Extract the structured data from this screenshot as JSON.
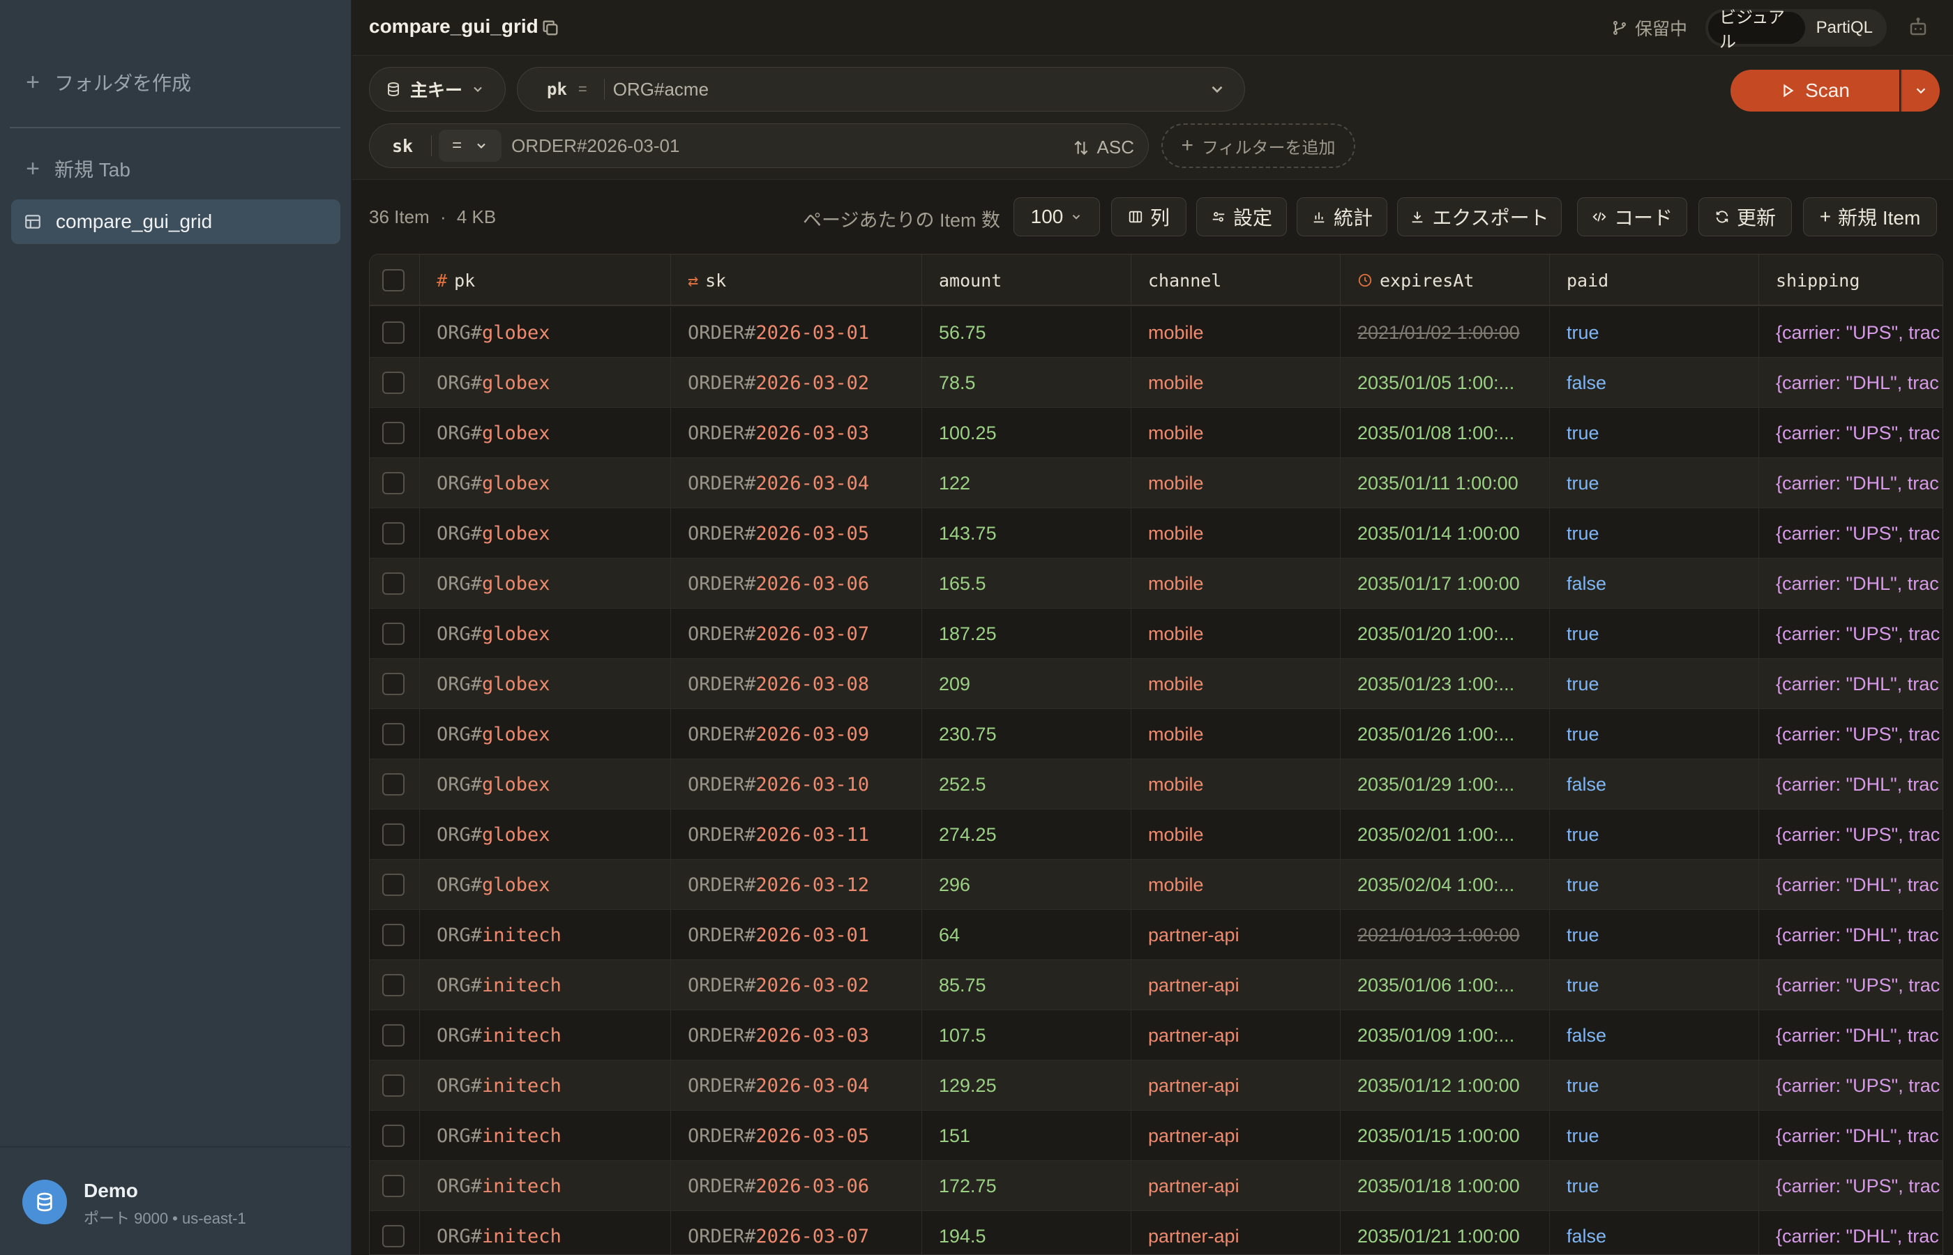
{
  "sidebar": {
    "create_folder": "フォルダを作成",
    "new_tab": "新規 Tab",
    "active_tab": "compare_gui_grid",
    "connection": {
      "name": "Demo",
      "detail": "ポート 9000 • us-east-1"
    }
  },
  "header": {
    "title": "compare_gui_grid",
    "pending": "保留中",
    "modes": [
      "ビジュアル",
      "PartiQL"
    ]
  },
  "query": {
    "index_label": "主キー",
    "pk_name": "pk",
    "pk_op": "=",
    "pk_value": "ORG#acme",
    "sk_name": "sk",
    "sk_op": "=",
    "sk_value": "ORDER#2026-03-01",
    "sort": "ASC",
    "add_filter": "フィルターを追加",
    "scan_label": "Scan"
  },
  "toolbar": {
    "item_count": "36 Item",
    "size": "4 KB",
    "per_page_label": "ページあたりの Item 数",
    "per_page_value": "100",
    "columns": "列",
    "settings": "設定",
    "stats": "統計",
    "export": "エクスポート",
    "code": "コード",
    "refresh": "更新",
    "new_item": "新規 Item"
  },
  "table": {
    "columns": [
      "pk",
      "sk",
      "amount",
      "channel",
      "expiresAt",
      "paid",
      "shipping"
    ],
    "rows": [
      {
        "pk_prefix": "ORG#",
        "pk_value": "globex",
        "sk_prefix": "ORDER#",
        "sk_value": "2026-03-01",
        "amount": "56.75",
        "channel": "mobile",
        "expiresAt": "2021/01/02 1:00:00",
        "expired": true,
        "paid": "true",
        "shipping": "{carrier: \"UPS\", trac"
      },
      {
        "pk_prefix": "ORG#",
        "pk_value": "globex",
        "sk_prefix": "ORDER#",
        "sk_value": "2026-03-02",
        "amount": "78.5",
        "channel": "mobile",
        "expiresAt": "2035/01/05 1:00:...",
        "expired": false,
        "paid": "false",
        "shipping": "{carrier: \"DHL\", trac"
      },
      {
        "pk_prefix": "ORG#",
        "pk_value": "globex",
        "sk_prefix": "ORDER#",
        "sk_value": "2026-03-03",
        "amount": "100.25",
        "channel": "mobile",
        "expiresAt": "2035/01/08 1:00:...",
        "expired": false,
        "paid": "true",
        "shipping": "{carrier: \"UPS\", trac"
      },
      {
        "pk_prefix": "ORG#",
        "pk_value": "globex",
        "sk_prefix": "ORDER#",
        "sk_value": "2026-03-04",
        "amount": "122",
        "channel": "mobile",
        "expiresAt": "2035/01/11 1:00:00",
        "expired": false,
        "paid": "true",
        "shipping": "{carrier: \"DHL\", trac"
      },
      {
        "pk_prefix": "ORG#",
        "pk_value": "globex",
        "sk_prefix": "ORDER#",
        "sk_value": "2026-03-05",
        "amount": "143.75",
        "channel": "mobile",
        "expiresAt": "2035/01/14 1:00:00",
        "expired": false,
        "paid": "true",
        "shipping": "{carrier: \"UPS\", trac"
      },
      {
        "pk_prefix": "ORG#",
        "pk_value": "globex",
        "sk_prefix": "ORDER#",
        "sk_value": "2026-03-06",
        "amount": "165.5",
        "channel": "mobile",
        "expiresAt": "2035/01/17 1:00:00",
        "expired": false,
        "paid": "false",
        "shipping": "{carrier: \"DHL\", trac"
      },
      {
        "pk_prefix": "ORG#",
        "pk_value": "globex",
        "sk_prefix": "ORDER#",
        "sk_value": "2026-03-07",
        "amount": "187.25",
        "channel": "mobile",
        "expiresAt": "2035/01/20 1:00:...",
        "expired": false,
        "paid": "true",
        "shipping": "{carrier: \"UPS\", trac"
      },
      {
        "pk_prefix": "ORG#",
        "pk_value": "globex",
        "sk_prefix": "ORDER#",
        "sk_value": "2026-03-08",
        "amount": "209",
        "channel": "mobile",
        "expiresAt": "2035/01/23 1:00:...",
        "expired": false,
        "paid": "true",
        "shipping": "{carrier: \"DHL\", trac"
      },
      {
        "pk_prefix": "ORG#",
        "pk_value": "globex",
        "sk_prefix": "ORDER#",
        "sk_value": "2026-03-09",
        "amount": "230.75",
        "channel": "mobile",
        "expiresAt": "2035/01/26 1:00:...",
        "expired": false,
        "paid": "true",
        "shipping": "{carrier: \"UPS\", trac"
      },
      {
        "pk_prefix": "ORG#",
        "pk_value": "globex",
        "sk_prefix": "ORDER#",
        "sk_value": "2026-03-10",
        "amount": "252.5",
        "channel": "mobile",
        "expiresAt": "2035/01/29 1:00:...",
        "expired": false,
        "paid": "false",
        "shipping": "{carrier: \"DHL\", trac"
      },
      {
        "pk_prefix": "ORG#",
        "pk_value": "globex",
        "sk_prefix": "ORDER#",
        "sk_value": "2026-03-11",
        "amount": "274.25",
        "channel": "mobile",
        "expiresAt": "2035/02/01 1:00:...",
        "expired": false,
        "paid": "true",
        "shipping": "{carrier: \"UPS\", trac"
      },
      {
        "pk_prefix": "ORG#",
        "pk_value": "globex",
        "sk_prefix": "ORDER#",
        "sk_value": "2026-03-12",
        "amount": "296",
        "channel": "mobile",
        "expiresAt": "2035/02/04 1:00:...",
        "expired": false,
        "paid": "true",
        "shipping": "{carrier: \"DHL\", trac"
      },
      {
        "pk_prefix": "ORG#",
        "pk_value": "initech",
        "sk_prefix": "ORDER#",
        "sk_value": "2026-03-01",
        "amount": "64",
        "channel": "partner-api",
        "expiresAt": "2021/01/03 1:00:00",
        "expired": true,
        "paid": "true",
        "shipping": "{carrier: \"DHL\", trac"
      },
      {
        "pk_prefix": "ORG#",
        "pk_value": "initech",
        "sk_prefix": "ORDER#",
        "sk_value": "2026-03-02",
        "amount": "85.75",
        "channel": "partner-api",
        "expiresAt": "2035/01/06 1:00:...",
        "expired": false,
        "paid": "true",
        "shipping": "{carrier: \"UPS\", trac"
      },
      {
        "pk_prefix": "ORG#",
        "pk_value": "initech",
        "sk_prefix": "ORDER#",
        "sk_value": "2026-03-03",
        "amount": "107.5",
        "channel": "partner-api",
        "expiresAt": "2035/01/09 1:00:...",
        "expired": false,
        "paid": "false",
        "shipping": "{carrier: \"DHL\", trac"
      },
      {
        "pk_prefix": "ORG#",
        "pk_value": "initech",
        "sk_prefix": "ORDER#",
        "sk_value": "2026-03-04",
        "amount": "129.25",
        "channel": "partner-api",
        "expiresAt": "2035/01/12 1:00:00",
        "expired": false,
        "paid": "true",
        "shipping": "{carrier: \"UPS\", trac"
      },
      {
        "pk_prefix": "ORG#",
        "pk_value": "initech",
        "sk_prefix": "ORDER#",
        "sk_value": "2026-03-05",
        "amount": "151",
        "channel": "partner-api",
        "expiresAt": "2035/01/15 1:00:00",
        "expired": false,
        "paid": "true",
        "shipping": "{carrier: \"DHL\", trac"
      },
      {
        "pk_prefix": "ORG#",
        "pk_value": "initech",
        "sk_prefix": "ORDER#",
        "sk_value": "2026-03-06",
        "amount": "172.75",
        "channel": "partner-api",
        "expiresAt": "2035/01/18 1:00:00",
        "expired": false,
        "paid": "true",
        "shipping": "{carrier: \"UPS\", trac"
      },
      {
        "pk_prefix": "ORG#",
        "pk_value": "initech",
        "sk_prefix": "ORDER#",
        "sk_value": "2026-03-07",
        "amount": "194.5",
        "channel": "partner-api",
        "expiresAt": "2035/01/21 1:00:00",
        "expired": false,
        "paid": "false",
        "shipping": "{carrier: \"DHL\", trac"
      }
    ]
  },
  "colors": {
    "accent": "#c54a23",
    "string_value": "#ef8a6e",
    "number_value": "#9bd184",
    "boolean_value": "#7fb6f5",
    "map_value": "#d79ae8"
  }
}
